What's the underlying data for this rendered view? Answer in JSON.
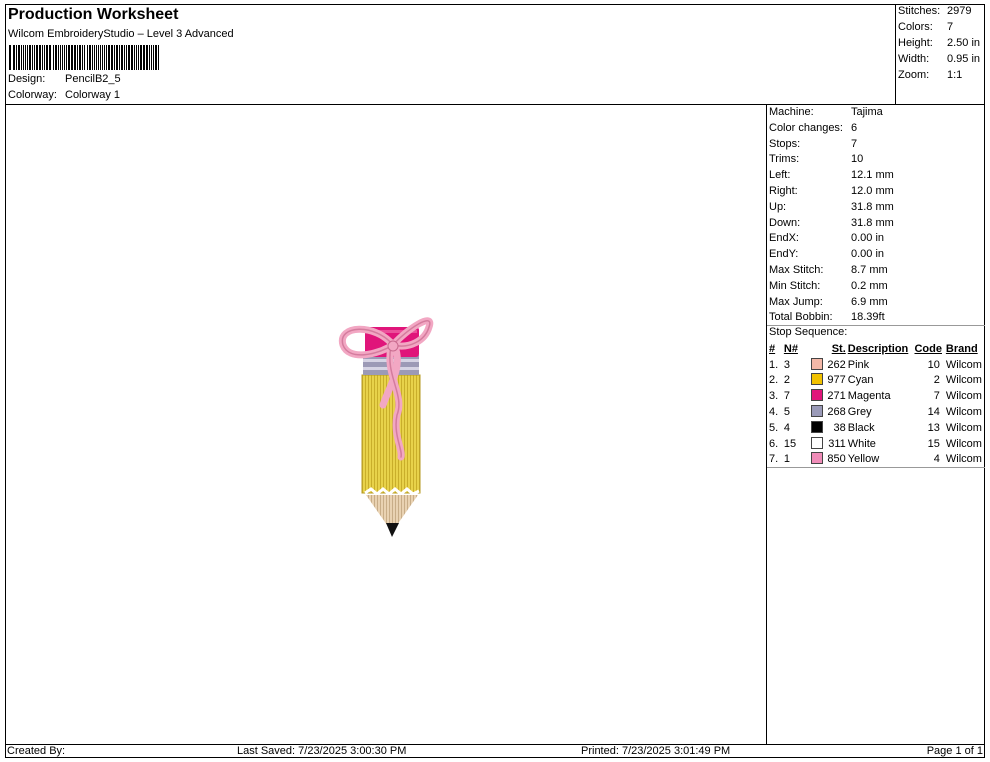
{
  "header": {
    "title": "Production Worksheet",
    "subtitle": "Wilcom EmbroideryStudio – Level 3 Advanced",
    "design_label": "Design:",
    "design_value": "PencilB2_5",
    "colorway_label": "Colorway:",
    "colorway_value": "Colorway 1"
  },
  "summary": [
    {
      "label": "Stitches:",
      "value": "2979"
    },
    {
      "label": "Colors:",
      "value": "7"
    },
    {
      "label": "Height:",
      "value": "2.50 in"
    },
    {
      "label": "Width:",
      "value": "0.95 in"
    },
    {
      "label": "Zoom:",
      "value": "1:1"
    }
  ],
  "machine": [
    {
      "label": "Machine:",
      "value": "Tajima"
    },
    {
      "label": "Color changes:",
      "value": "6"
    },
    {
      "label": "Stops:",
      "value": "7"
    },
    {
      "label": "Trims:",
      "value": "10"
    },
    {
      "label": "Left:",
      "value": "12.1 mm"
    },
    {
      "label": "Right:",
      "value": "12.0 mm"
    },
    {
      "label": "Up:",
      "value": "31.8 mm"
    },
    {
      "label": "Down:",
      "value": "31.8 mm"
    },
    {
      "label": "EndX:",
      "value": "0.00 in"
    },
    {
      "label": "EndY:",
      "value": "0.00 in"
    },
    {
      "label": "Max Stitch:",
      "value": "8.7 mm"
    },
    {
      "label": "Min Stitch:",
      "value": "0.2 mm"
    },
    {
      "label": "Max Jump:",
      "value": "6.9 mm"
    },
    {
      "label": "Total Bobbin:",
      "value": "18.39ft"
    }
  ],
  "stop_sequence": {
    "title": "Stop Sequence:",
    "headers": {
      "num": "#",
      "n": "N#",
      "st": "St.",
      "desc": "Description",
      "code": "Code",
      "brand": "Brand"
    },
    "rows": [
      {
        "num": "1.",
        "n": "3",
        "color": "#f4b8a8",
        "st": "262",
        "desc": "Pink",
        "code": "10",
        "brand": "Wilcom"
      },
      {
        "num": "2.",
        "n": "2",
        "color": "#f2c200",
        "st": "977",
        "desc": "Cyan",
        "code": "2",
        "brand": "Wilcom"
      },
      {
        "num": "3.",
        "n": "7",
        "color": "#e0157a",
        "st": "271",
        "desc": "Magenta",
        "code": "7",
        "brand": "Wilcom"
      },
      {
        "num": "4.",
        "n": "5",
        "color": "#9a9ab8",
        "st": "268",
        "desc": "Grey",
        "code": "14",
        "brand": "Wilcom"
      },
      {
        "num": "5.",
        "n": "4",
        "color": "#000000",
        "st": "38",
        "desc": "Black",
        "code": "13",
        "brand": "Wilcom"
      },
      {
        "num": "6.",
        "n": "15",
        "color": "#ffffff",
        "st": "311",
        "desc": "White",
        "code": "15",
        "brand": "Wilcom"
      },
      {
        "num": "7.",
        "n": "1",
        "color": "#f08cb8",
        "st": "850",
        "desc": "Yellow",
        "code": "4",
        "brand": "Wilcom"
      }
    ]
  },
  "footer": {
    "created_by": "Created By:",
    "last_saved": "Last Saved: 7/23/2025 3:00:30 PM",
    "printed": "Printed: 7/23/2025 3:01:49 PM",
    "page": "Page 1 of 1"
  }
}
